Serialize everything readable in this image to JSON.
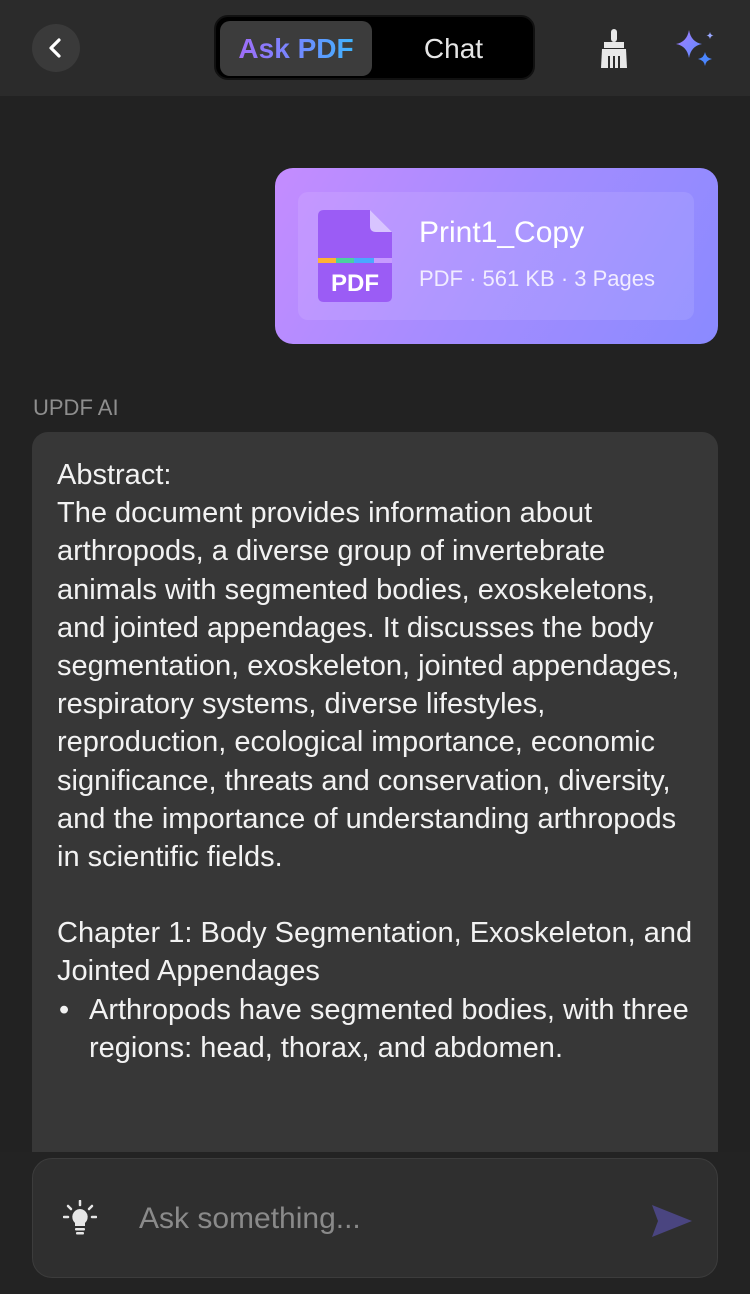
{
  "header": {
    "tabs": [
      {
        "label": "Ask PDF",
        "active": true
      },
      {
        "label": "Chat",
        "active": false
      }
    ]
  },
  "attachment": {
    "name": "Print1_Copy",
    "meta": "PDF · 561 KB · 3 Pages",
    "icon_label": "PDF"
  },
  "message": {
    "sender": "UPDF AI",
    "abstract_title": "Abstract:",
    "abstract_text": "The document provides information about arthropods, a diverse group of invertebrate animals with segmented bodies, exoskeletons, and jointed appendages. It discusses the body segmentation, exoskeleton, jointed appendages, respiratory systems, diverse lifestyles, reproduction, ecological importance, economic significance, threats and conservation, diversity, and the importance of understanding arthropods in scientific fields.",
    "chapter_title": "Chapter 1: Body Segmentation, Exoskeleton, and Jointed Appendages",
    "bullets": [
      "Arthropods have segmented bodies, with three regions: head, thorax, and abdomen."
    ]
  },
  "composer": {
    "placeholder": "Ask something..."
  },
  "colors": {
    "background": "#222222",
    "header": "#2b2b2b",
    "bubble": "#373737",
    "accent_start": "#a06cf8",
    "accent_end": "#3fb5ff",
    "card_start": "#c48cff",
    "card_end": "#8a8aff",
    "send": "#4a4580"
  }
}
